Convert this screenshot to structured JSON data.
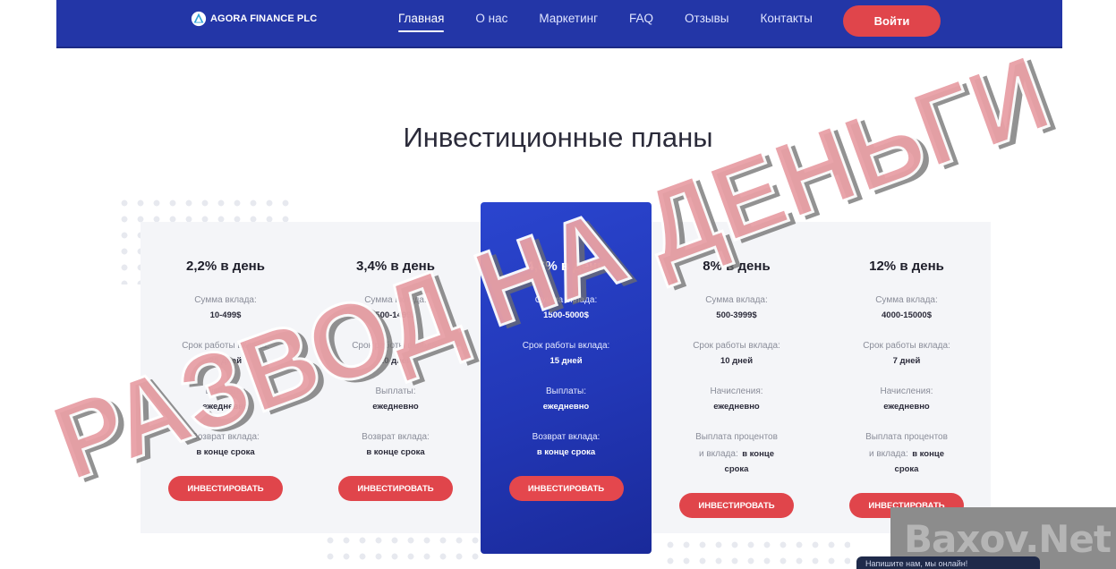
{
  "header": {
    "logo_text": "AGORA FINANCE PLC",
    "menu": [
      {
        "label": "Главная"
      },
      {
        "label": "О нас"
      },
      {
        "label": "Маркетинг"
      },
      {
        "label": "FAQ"
      },
      {
        "label": "Отзывы"
      },
      {
        "label": "Контакты"
      }
    ],
    "login_label": "Войти"
  },
  "title": "Инвестиционные планы",
  "plans": [
    {
      "rate": "2,2% в день",
      "rows": [
        {
          "label": "Сумма вклада:",
          "value": "10-499$"
        },
        {
          "label": "Срок работы вклада:",
          "value": "25 дней"
        },
        {
          "label": "Выплаты:",
          "value": "ежедневно"
        },
        {
          "label": "Возврат вклада:",
          "value": "в конце срока"
        }
      ],
      "button": "ИНВЕСТИРОВАТЬ"
    },
    {
      "rate": "3,4% в день",
      "rows": [
        {
          "label": "Сумма вклада:",
          "value": "500-1499$"
        },
        {
          "label": "Срок работы вклада:",
          "value": "20 дней"
        },
        {
          "label": "Выплаты:",
          "value": "ежедневно"
        },
        {
          "label": "Возврат вклада:",
          "value": "в конце срока"
        }
      ],
      "button": "ИНВЕСТИРОВАТЬ"
    },
    {
      "rate": "4,6% в день",
      "rows": [
        {
          "label": "Сумма вклада:",
          "value": "1500-5000$"
        },
        {
          "label": "Срок работы вклада:",
          "value": "15 дней"
        },
        {
          "label": "Выплаты:",
          "value": "ежедневно"
        },
        {
          "label": "Возврат вклада:",
          "value": "в конце срока"
        }
      ],
      "button": "ИНВЕСТИРОВАТЬ"
    },
    {
      "rate": "8% в день",
      "rows": [
        {
          "label": "Сумма вклада:",
          "value": "500-3999$"
        },
        {
          "label": "Срок работы вклада:",
          "value": "10 дней"
        },
        {
          "label": "Начисления:",
          "value": "ежедневно"
        },
        {
          "label": "Выплата процентов",
          "label2": "и вклада:",
          "value": "в конце",
          "value2": "срока"
        }
      ],
      "button": "ИНВЕСТИРОВАТЬ"
    },
    {
      "rate": "12% в день",
      "rows": [
        {
          "label": "Сумма вклада:",
          "value": "4000-15000$"
        },
        {
          "label": "Срок работы вклада:",
          "value": "7 дней"
        },
        {
          "label": "Начисления:",
          "value": "ежедневно"
        },
        {
          "label": "Выплата процентов",
          "label2": "и вклада:",
          "value": "в конце",
          "value2": "срока"
        }
      ],
      "button": "ИНВЕСТИРОВАТЬ"
    }
  ],
  "overlay": {
    "stamp_text": "РАЗВОД НА ДЕНЬГИ",
    "stamp_color": "#e8a0a6",
    "watermark": "Baxov.Net",
    "chat_text": "Напишите нам, мы онлайн!"
  },
  "colors": {
    "nav_bg": "#2336a7",
    "accent_red": "#e0454b",
    "featured_bg": "#2237b6",
    "panel_bg": "#f4f5f8"
  }
}
